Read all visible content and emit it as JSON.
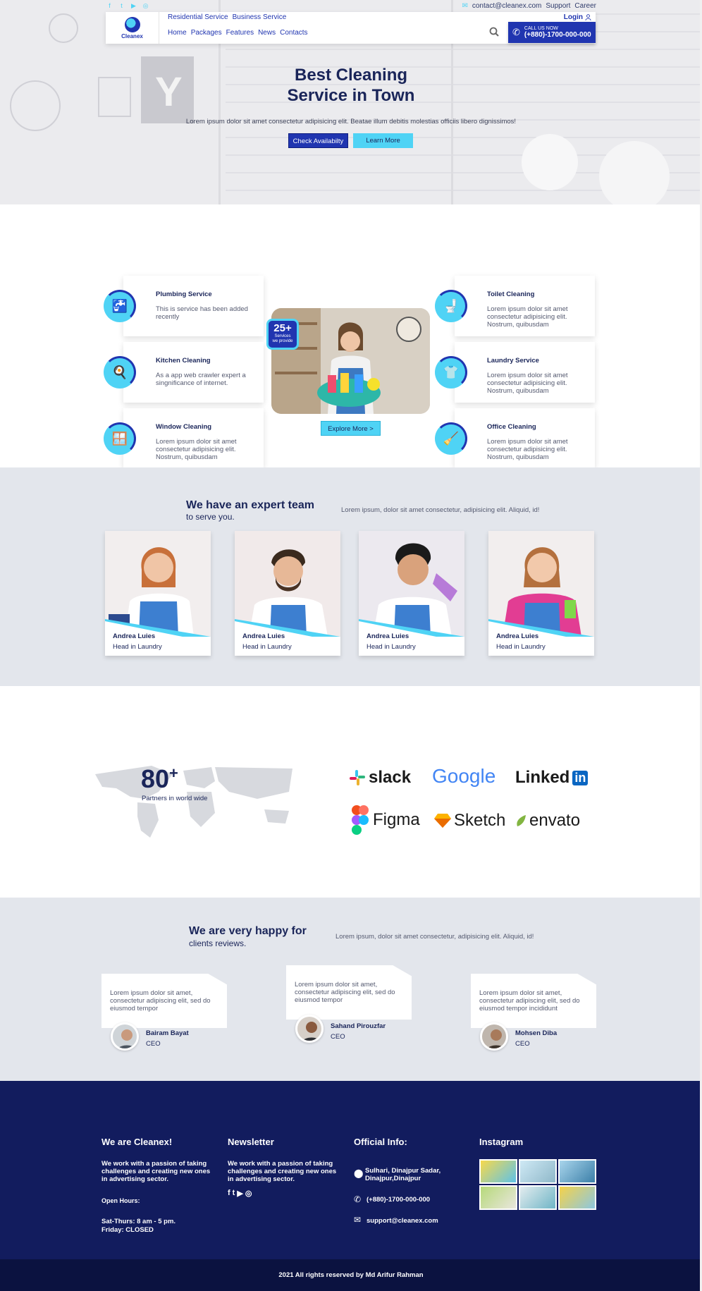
{
  "topbar": {
    "social_icons": [
      "facebook-icon",
      "twitter-icon",
      "youtube-icon",
      "instagram-icon"
    ],
    "email": "contact@cleanex.com",
    "links": [
      "Support",
      "Career"
    ]
  },
  "nav": {
    "logo_text": "Cleanex",
    "top_links": [
      "Residential Service",
      "Business Service"
    ],
    "main_links": [
      "Home",
      "Packages",
      "Features",
      "News",
      "Contacts"
    ],
    "login": "Login",
    "call_label": "CALL US NOW",
    "call_number": "(+880)-1700-000-000"
  },
  "hero": {
    "title_line1": "Best Cleaning",
    "title_line2": "Service in Town",
    "subtitle": "Lorem ipsum dolor sit amet consectetur adipisicing elit. Beatae illum debitis molestias officiis libero dignissimos!",
    "btn_primary": "Check Availabilty",
    "btn_secondary": "Learn More"
  },
  "services": {
    "items": [
      {
        "title": "Plumbing Service",
        "desc": "This is service has been added recently",
        "icon": "faucet-icon"
      },
      {
        "title": "Kitchen Cleaning",
        "desc": "As a app web crawler expert a singnificance of internet.",
        "icon": "kitchen-icon"
      },
      {
        "title": "Window Cleaning",
        "desc": "Lorem ipsum dolor sit amet consectetur adipisicing elit. Nostrum, quibusdam",
        "icon": "window-icon"
      },
      {
        "title": "Toilet Cleaning",
        "desc": "Lorem ipsum dolor sit amet consectetur adipisicing elit. Nostrum, quibusdam",
        "icon": "toilet-icon"
      },
      {
        "title": "Laundry Service",
        "desc": "Lorem ipsum dolor sit amet consectetur adipisicing elit. Nostrum, quibusdam",
        "icon": "laundry-icon"
      },
      {
        "title": "Office Cleaning",
        "desc": "Lorem ipsum dolor sit amet consectetur adipisicing elit. Nostrum, quibusdam",
        "icon": "office-icon"
      }
    ],
    "badge_number": "25+",
    "badge_line1": "Services",
    "badge_line2": "we provide",
    "explore_btn": "Explore More >"
  },
  "team": {
    "heading": "We have an expert team",
    "subheading": "to serve you.",
    "lorem": "Lorem ipsum, dolor sit amet consectetur, adipisicing elit. Aliquid, id!",
    "members": [
      {
        "name": "Andrea Luies",
        "role": "Head in Laundry"
      },
      {
        "name": "Andrea Luies",
        "role": "Head in Laundry"
      },
      {
        "name": "Andrea Luies",
        "role": "Head in Laundry"
      },
      {
        "name": "Andrea Luies",
        "role": "Head in Laundry"
      }
    ]
  },
  "partners": {
    "number": "80",
    "plus": "+",
    "label": "Partners in world wide",
    "logos": [
      "slack",
      "Google",
      "Linked",
      "in",
      "Figma",
      "Sketch",
      "envato"
    ]
  },
  "reviews": {
    "heading": "We are very happy for",
    "subheading": "clients reviews.",
    "lorem": "Lorem ipsum, dolor sit amet consectetur, adipisicing elit. Aliquid, id!",
    "items": [
      {
        "text": "Lorem ipsum dolor sit amet, consectetur adipiscing elit, sed do eiusmod tempor",
        "name": "Bairam Bayat",
        "role": "CEO"
      },
      {
        "text": "Lorem ipsum dolor sit amet, consectetur adipiscing elit, sed do eiusmod tempor",
        "name": "Sahand Pirouzfar",
        "role": "CEO"
      },
      {
        "text": "Lorem ipsum dolor sit amet, consectetur adipiscing elit, sed do eiusmod tempor incididunt",
        "name": "Mohsen Diba",
        "role": "CEO"
      }
    ]
  },
  "footer": {
    "about_title": "We are Cleanex!",
    "about_text": "We work with a passion of taking challenges and creating new ones in advertising sector.",
    "hours_title": "Open Hours:",
    "hours_line1": "Sat-Thurs: 8 am - 5 pm.",
    "hours_line2": "Friday: CLOSED",
    "newsletter_title": "Newsletter",
    "newsletter_text": "We work with a passion of taking challenges and creating new ones in advertising sector.",
    "info_title": "Official Info:",
    "address": "Sulhari, Dinajpur Sadar, Dinajpur,Dinajpur",
    "phone": "(+880)-1700-000-000",
    "email": "support@cleanex.com",
    "instagram_title": "Instagram",
    "copyright": "2021 All rights reserved by Md Arifur Rahman"
  },
  "colors": {
    "brand_blue": "#2035b0",
    "accent_cyan": "#4fd3f5",
    "navy": "#1a2559",
    "footer_bg": "#121c5e"
  }
}
